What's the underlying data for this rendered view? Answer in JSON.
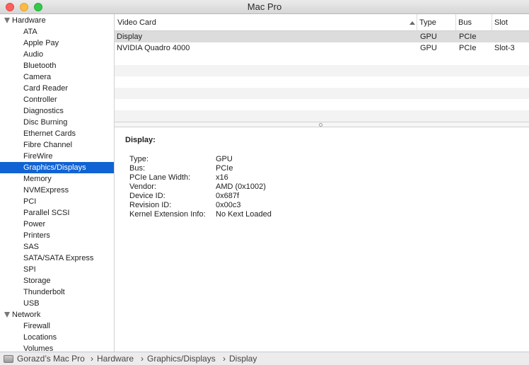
{
  "window": {
    "title": "Mac Pro"
  },
  "sidebar": {
    "groups": [
      {
        "label": "Hardware",
        "items": [
          "ATA",
          "Apple Pay",
          "Audio",
          "Bluetooth",
          "Camera",
          "Card Reader",
          "Controller",
          "Diagnostics",
          "Disc Burning",
          "Ethernet Cards",
          "Fibre Channel",
          "FireWire",
          "Graphics/Displays",
          "Memory",
          "NVMExpress",
          "PCI",
          "Parallel SCSI",
          "Power",
          "Printers",
          "SAS",
          "SATA/SATA Express",
          "SPI",
          "Storage",
          "Thunderbolt",
          "USB"
        ]
      },
      {
        "label": "Network",
        "items": [
          "Firewall",
          "Locations",
          "Volumes"
        ]
      }
    ],
    "selected": "Graphics/Displays"
  },
  "table": {
    "columns": {
      "name": "Video Card",
      "type": "Type",
      "bus": "Bus",
      "slot": "Slot"
    },
    "rows": [
      {
        "name": "Display",
        "type": "GPU",
        "bus": "PCIe",
        "slot": ""
      },
      {
        "name": "NVIDIA Quadro 4000",
        "type": "GPU",
        "bus": "PCIe",
        "slot": "Slot-3"
      }
    ],
    "selected_row": 0
  },
  "detail": {
    "title": "Display:",
    "properties": [
      {
        "label": "Type:",
        "value": "GPU"
      },
      {
        "label": "Bus:",
        "value": "PCIe"
      },
      {
        "label": "PCIe Lane Width:",
        "value": "x16"
      },
      {
        "label": "Vendor:",
        "value": "AMD (0x1002)"
      },
      {
        "label": "Device ID:",
        "value": "0x687f"
      },
      {
        "label": "Revision ID:",
        "value": "0x00c3"
      },
      {
        "label": "Kernel Extension Info:",
        "value": "No Kext Loaded"
      }
    ]
  },
  "statusbar": {
    "crumbs": [
      "Gorazd’s Mac Pro",
      "Hardware",
      "Graphics/Displays",
      "Display"
    ],
    "separator": "›"
  }
}
